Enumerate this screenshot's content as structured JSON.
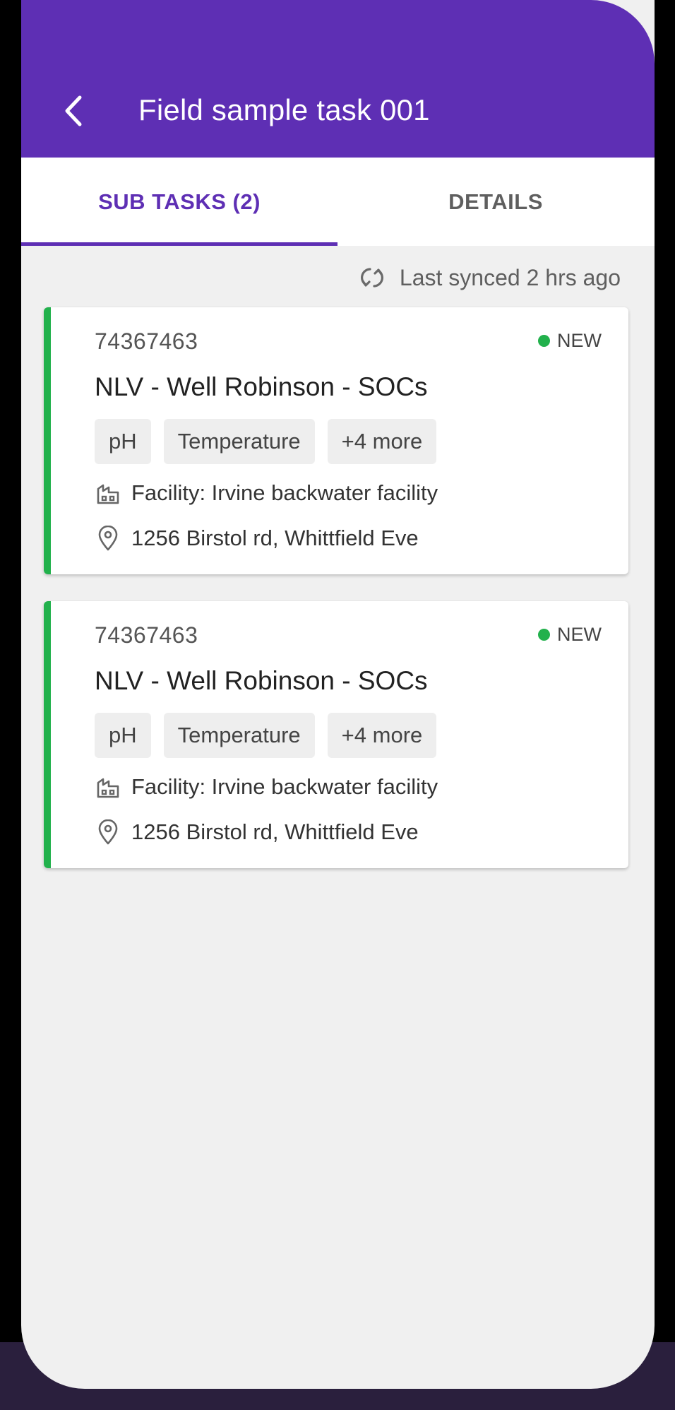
{
  "header": {
    "title": "Field sample task 001",
    "back_icon": "chevron-left-icon"
  },
  "tabs": [
    {
      "label": "SUB TASKS (2)",
      "active": true
    },
    {
      "label": "DETAILS",
      "active": false
    }
  ],
  "sync": {
    "text": "Last synced 2 hrs ago",
    "icon": "sync-icon"
  },
  "colors": {
    "brand": "#5e2fb4",
    "status_new": "#22b14c",
    "background": "#f0f0f0"
  },
  "cards": [
    {
      "id": "74367463",
      "status": "NEW",
      "title": "NLV - Well Robinson - SOCs",
      "chips": [
        "pH",
        "Temperature",
        "+4 more"
      ],
      "facility": "Facility: Irvine backwater facility",
      "address": "1256 Birstol rd, Whittfield Eve"
    },
    {
      "id": "74367463",
      "status": "NEW",
      "title": "NLV - Well Robinson - SOCs",
      "chips": [
        "pH",
        "Temperature",
        "+4 more"
      ],
      "facility": "Facility: Irvine backwater facility",
      "address": "1256 Birstol rd, Whittfield Eve"
    }
  ]
}
